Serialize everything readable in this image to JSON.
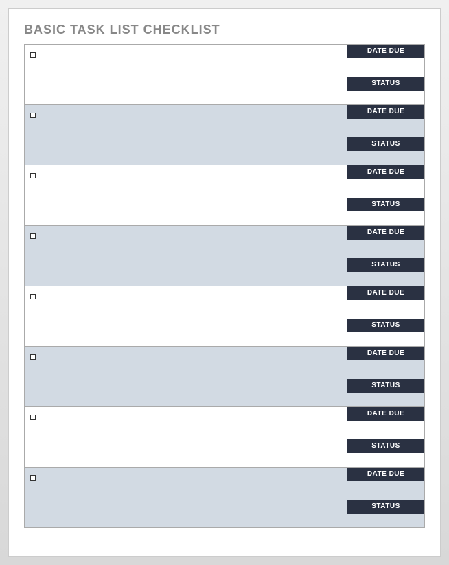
{
  "title": "BASIC TASK LIST CHECKLIST",
  "labels": {
    "date_due": "DATE DUE",
    "status": "STATUS"
  },
  "rows": [
    {
      "checked": false,
      "task": "",
      "date_due": "",
      "status": "",
      "alt": false
    },
    {
      "checked": false,
      "task": "",
      "date_due": "",
      "status": "",
      "alt": true
    },
    {
      "checked": false,
      "task": "",
      "date_due": "",
      "status": "",
      "alt": false
    },
    {
      "checked": false,
      "task": "",
      "date_due": "",
      "status": "",
      "alt": true
    },
    {
      "checked": false,
      "task": "",
      "date_due": "",
      "status": "",
      "alt": false
    },
    {
      "checked": false,
      "task": "",
      "date_due": "",
      "status": "",
      "alt": true
    },
    {
      "checked": false,
      "task": "",
      "date_due": "",
      "status": "",
      "alt": false
    },
    {
      "checked": false,
      "task": "",
      "date_due": "",
      "status": "",
      "alt": true
    }
  ]
}
